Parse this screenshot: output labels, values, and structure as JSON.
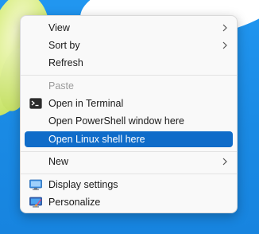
{
  "menu": {
    "items": {
      "view": {
        "label": "View",
        "icon": "chevron-right-icon"
      },
      "sort_by": {
        "label": "Sort by",
        "icon": "chevron-right-icon"
      },
      "refresh": {
        "label": "Refresh"
      },
      "paste": {
        "label": "Paste",
        "disabled": true
      },
      "terminal": {
        "label": "Open in Terminal",
        "icon": "terminal-icon"
      },
      "powershell": {
        "label": "Open PowerShell window here"
      },
      "linux": {
        "label": "Open Linux shell here",
        "highlighted": true
      },
      "new": {
        "label": "New",
        "icon": "chevron-right-icon"
      },
      "display": {
        "label": "Display settings",
        "icon": "display-icon"
      },
      "personalize": {
        "label": "Personalize",
        "icon": "personalize-icon"
      }
    }
  },
  "colors": {
    "highlight": "#0f6cc9",
    "menu_bg": "#f9f9f9",
    "desktop": "#1d8ee6"
  }
}
